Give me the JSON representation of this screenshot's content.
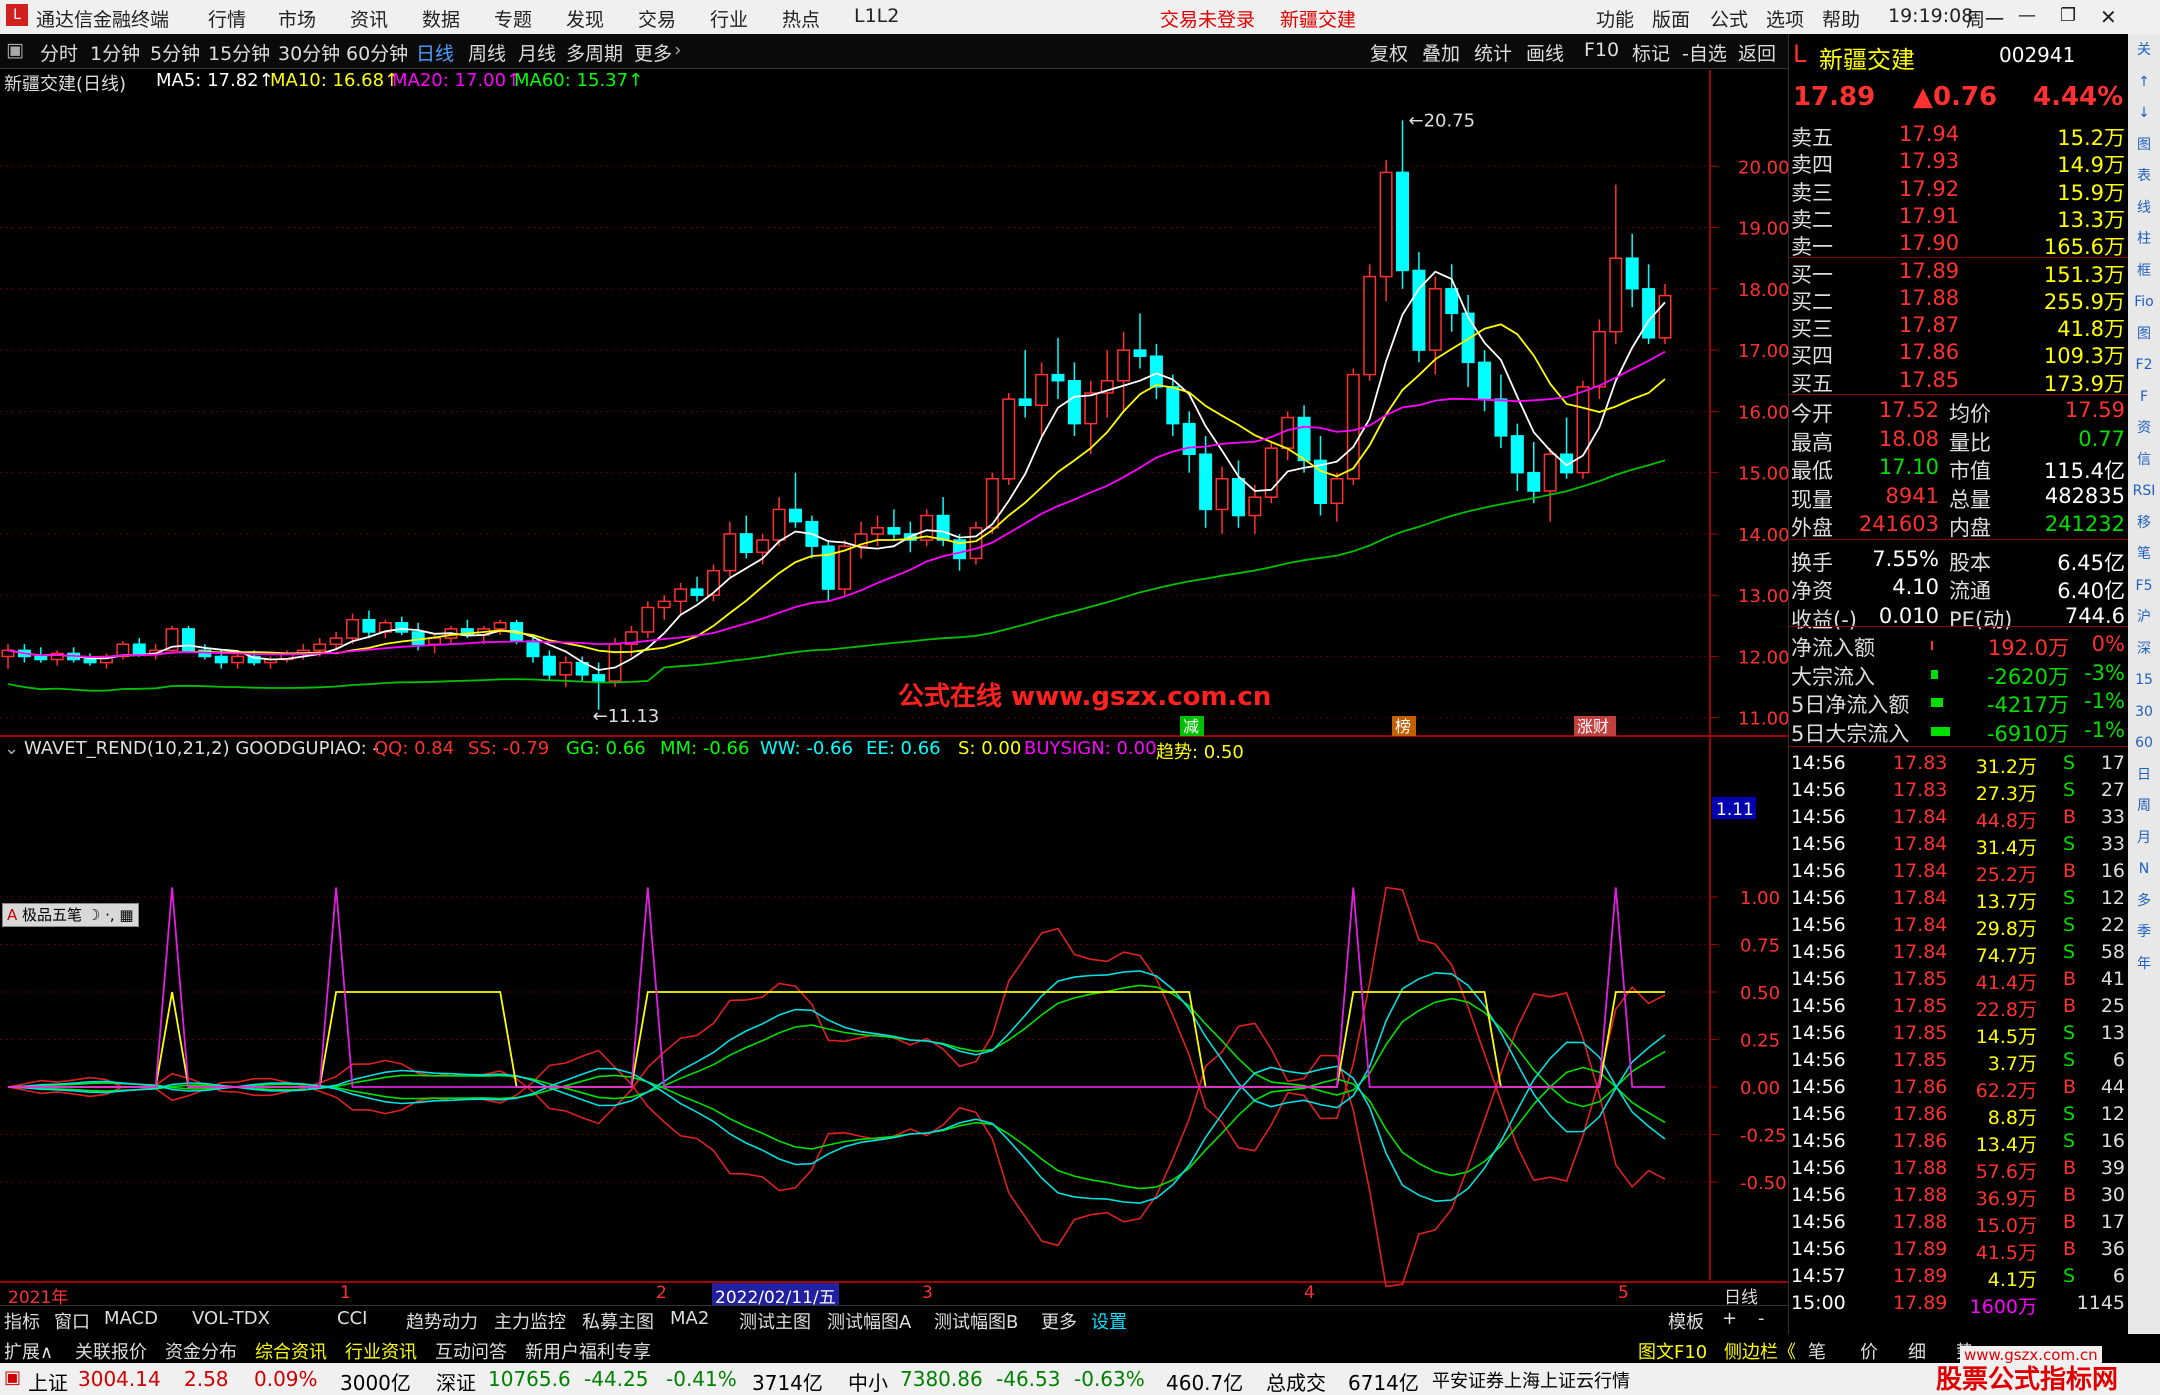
{
  "app": {
    "title": "通达信金融终端",
    "menu": [
      "行情",
      "市场",
      "资讯",
      "数据",
      "专题",
      "发现",
      "交易",
      "行业",
      "热点",
      "L1L2"
    ],
    "login_status": "交易未登录",
    "stock_tab": "新疆交建",
    "right_menu": [
      "功能",
      "版面",
      "公式",
      "选项",
      "帮助"
    ],
    "clock": "19:19:08",
    "weekday": "周一"
  },
  "toolbar": {
    "periods": [
      "分时",
      "1分钟",
      "5分钟",
      "15分钟",
      "30分钟",
      "60分钟",
      "日线",
      "周线",
      "月线",
      "多周期",
      "更多"
    ],
    "active_period": "日线",
    "actions": [
      "复权",
      "叠加",
      "统计",
      "画线",
      "F10",
      "标记",
      "-自选",
      "返回"
    ]
  },
  "main_chart": {
    "title": "新疆交建(日线)",
    "ma": [
      {
        "label": "MA5: 17.82",
        "color": "#ffffff"
      },
      {
        "label": "MA10: 16.68",
        "color": "#ffff00"
      },
      {
        "label": "MA20: 17.00",
        "color": "#ff00ff"
      },
      {
        "label": "MA60: 15.37",
        "color": "#00ff00"
      }
    ],
    "price_axis": [
      "20.00",
      "19.00",
      "18.00",
      "17.00",
      "16.00",
      "15.00",
      "14.00",
      "13.00",
      "12.00",
      "11.00"
    ],
    "high_marker": "20.75",
    "low_marker": "11.13",
    "watermark": "公式在线 www.gszx.com.cn",
    "event_tags": [
      {
        "label": "减",
        "color": "#00c000"
      },
      {
        "label": "榜",
        "color": "#c06000"
      },
      {
        "label": "涨财",
        "color": "#c04040"
      }
    ]
  },
  "indicator": {
    "title": "WAVET_REND(10,21,2) GOODGUPIAO: -",
    "values": [
      {
        "label": "QQ: 0.84",
        "color": "#ff3030"
      },
      {
        "label": "SS: -0.79",
        "color": "#ff3030"
      },
      {
        "label": "GG: 0.66",
        "color": "#00ff00"
      },
      {
        "label": "MM: -0.66",
        "color": "#00ff00"
      },
      {
        "label": "WW: -0.66",
        "color": "#00ffff"
      },
      {
        "label": "EE: 0.66",
        "color": "#00ffff"
      },
      {
        "label": "S: 0.00",
        "color": "#ffff00"
      },
      {
        "label": "BUYSIGN: 0.00",
        "color": "#ff00ff"
      },
      {
        "label": "趋势: 0.50",
        "color": "#ffff00"
      }
    ],
    "axis": [
      "1.00",
      "0.75",
      "0.50",
      "0.25",
      "0.00",
      "-0.25",
      "-0.50"
    ],
    "current_value": "1.11",
    "draw_tool": "极品五笔"
  },
  "time_axis": {
    "labels": [
      "2021年",
      "1",
      "2",
      "3",
      "4",
      "5"
    ],
    "cursor_date": "2022/02/11/五",
    "period": "日线"
  },
  "bottom_tabs": [
    "指标",
    "窗口",
    "MACD",
    "VOL-TDX",
    "CCI",
    "趋势动力",
    "主力监控",
    "私募主图",
    "MA2",
    "测试主图",
    "测试幅图A",
    "测试幅图B",
    "更多",
    "设置"
  ],
  "bottom_tabs_right": [
    "模板",
    "+",
    "-"
  ],
  "bottom_tabs2": [
    "扩展∧",
    "关联报价",
    "资金分布",
    "综合资讯",
    "行业资讯",
    "互动问答",
    "新用户福利专享"
  ],
  "bottom_tabs2_right": [
    "图文F10",
    "侧边栏《",
    "笔",
    "价",
    "细",
    "势"
  ],
  "quote": {
    "name": "新疆交建",
    "code": "002941",
    "price": "17.89",
    "change": "▲0.76",
    "pct": "4.44%",
    "asks": [
      {
        "label": "卖五",
        "price": "17.94",
        "vol": "15.2万"
      },
      {
        "label": "卖四",
        "price": "17.93",
        "vol": "14.9万"
      },
      {
        "label": "卖三",
        "price": "17.92",
        "vol": "15.9万"
      },
      {
        "label": "卖二",
        "price": "17.91",
        "vol": "13.3万"
      },
      {
        "label": "卖一",
        "price": "17.90",
        "vol": "165.6万"
      }
    ],
    "bids": [
      {
        "label": "买一",
        "price": "17.89",
        "vol": "151.3万"
      },
      {
        "label": "买二",
        "price": "17.88",
        "vol": "255.9万"
      },
      {
        "label": "买三",
        "price": "17.87",
        "vol": "41.8万"
      },
      {
        "label": "买四",
        "price": "17.86",
        "vol": "109.3万"
      },
      {
        "label": "买五",
        "price": "17.85",
        "vol": "173.9万"
      }
    ],
    "stats": [
      {
        "k1": "今开",
        "v1": "17.52",
        "c1": "#ff3030",
        "k2": "均价",
        "v2": "17.59",
        "c2": "#ff3030"
      },
      {
        "k1": "最高",
        "v1": "18.08",
        "c1": "#ff3030",
        "k2": "量比",
        "v2": "0.77",
        "c2": "#00e000"
      },
      {
        "k1": "最低",
        "v1": "17.10",
        "c1": "#00e000",
        "k2": "市值",
        "v2": "115.4亿",
        "c2": "#ffffff"
      },
      {
        "k1": "现量",
        "v1": "8941",
        "c1": "#ff3030",
        "k2": "总量",
        "v2": "482835",
        "c2": "#ffffff"
      },
      {
        "k1": "外盘",
        "v1": "241603",
        "c1": "#ff3030",
        "k2": "内盘",
        "v2": "241232",
        "c2": "#00e000"
      },
      {
        "k1": "换手",
        "v1": "7.55%",
        "c1": "#ffffff",
        "k2": "股本",
        "v2": "6.45亿",
        "c2": "#ffffff"
      },
      {
        "k1": "净资",
        "v1": "4.10",
        "c1": "#ffffff",
        "k2": "流通",
        "v2": "6.40亿",
        "c2": "#ffffff"
      },
      {
        "k1": "收益(-)",
        "v1": "0.010",
        "c1": "#ffffff",
        "k2": "PE(动)",
        "v2": "744.6",
        "c2": "#ffffff"
      }
    ],
    "flows": [
      {
        "label": "净流入额",
        "val": "192.0万",
        "pct": "0%",
        "color": "#ff3030",
        "bar": 0.02
      },
      {
        "label": "大宗流入",
        "val": "-2620万",
        "pct": "-3%",
        "color": "#00e000",
        "bar": 0.3
      },
      {
        "label": "5日净流入额",
        "val": "-4217万",
        "pct": "-1%",
        "color": "#00e000",
        "bar": 0.5
      },
      {
        "label": "5日大宗流入",
        "val": "-6910万",
        "pct": "-1%",
        "color": "#00e000",
        "bar": 0.8
      }
    ],
    "ticks": [
      {
        "t": "14:56",
        "p": "17.83",
        "v": "31.2万",
        "d": "S",
        "n": "17"
      },
      {
        "t": "14:56",
        "p": "17.83",
        "v": "27.3万",
        "d": "S",
        "n": "27"
      },
      {
        "t": "14:56",
        "p": "17.84",
        "v": "44.8万",
        "d": "B",
        "n": "33"
      },
      {
        "t": "14:56",
        "p": "17.84",
        "v": "31.4万",
        "d": "S",
        "n": "33"
      },
      {
        "t": "14:56",
        "p": "17.84",
        "v": "25.2万",
        "d": "B",
        "n": "16"
      },
      {
        "t": "14:56",
        "p": "17.84",
        "v": "13.7万",
        "d": "S",
        "n": "12"
      },
      {
        "t": "14:56",
        "p": "17.84",
        "v": "29.8万",
        "d": "S",
        "n": "22"
      },
      {
        "t": "14:56",
        "p": "17.84",
        "v": "74.7万",
        "d": "S",
        "n": "58"
      },
      {
        "t": "14:56",
        "p": "17.85",
        "v": "41.4万",
        "d": "B",
        "n": "41"
      },
      {
        "t": "14:56",
        "p": "17.85",
        "v": "22.8万",
        "d": "B",
        "n": "25"
      },
      {
        "t": "14:56",
        "p": "17.85",
        "v": "14.5万",
        "d": "S",
        "n": "13"
      },
      {
        "t": "14:56",
        "p": "17.85",
        "v": "3.7万",
        "d": "S",
        "n": "6"
      },
      {
        "t": "14:56",
        "p": "17.86",
        "v": "62.2万",
        "d": "B",
        "n": "44"
      },
      {
        "t": "14:56",
        "p": "17.86",
        "v": "8.8万",
        "d": "S",
        "n": "12"
      },
      {
        "t": "14:56",
        "p": "17.86",
        "v": "13.4万",
        "d": "S",
        "n": "16"
      },
      {
        "t": "14:56",
        "p": "17.88",
        "v": "57.6万",
        "d": "B",
        "n": "39"
      },
      {
        "t": "14:56",
        "p": "17.88",
        "v": "36.9万",
        "d": "B",
        "n": "30"
      },
      {
        "t": "14:56",
        "p": "17.88",
        "v": "15.0万",
        "d": "B",
        "n": "17"
      },
      {
        "t": "14:56",
        "p": "17.89",
        "v": "41.5万",
        "d": "B",
        "n": "36"
      },
      {
        "t": "14:57",
        "p": "17.89",
        "v": "4.1万",
        "d": "S",
        "n": "6"
      },
      {
        "t": "15:00",
        "p": "17.89",
        "v": "1600万",
        "d": "",
        "n": "1145"
      }
    ]
  },
  "right_icons": [
    "关",
    "↑",
    "↓",
    "图",
    "表",
    "线",
    "柱",
    "框",
    "Fio",
    "图",
    "F2",
    "F",
    "资",
    "信",
    "RSI",
    "移",
    "笔",
    "F5",
    "沪",
    "深",
    "15",
    "30",
    "60",
    "日",
    "周",
    "月",
    "N",
    "多",
    "季",
    "年"
  ],
  "status": {
    "sh_label": "上证",
    "sh_val": "3004.14",
    "sh_chg": "2.58",
    "sh_pct": "0.09%",
    "sh_amt": "3000亿",
    "sz_label": "深证",
    "sz_val": "10765.6",
    "sz_chg": "-44.25",
    "sz_pct": "-0.41%",
    "sz_amt": "3714亿",
    "zx_label": "中小",
    "zx_val": "7380.86",
    "zx_chg": "-46.53",
    "zx_pct": "-0.63%",
    "zx_amt": "460.7亿",
    "total_label": "总成交",
    "total_val": "6714亿",
    "broker": "平安证券上海上证云行情",
    "brand": "股票公式指标网",
    "brand_url": "www.gszx.com.cn"
  },
  "colors": {
    "up": "#ff3030",
    "down": "#00ffff",
    "ma5": "#ffffff",
    "ma10": "#ffff00",
    "ma20": "#ff00ff",
    "ma60": "#00c000"
  },
  "chart_data": {
    "type": "candlestick",
    "price_range": [
      10.8,
      21.0
    ],
    "ohlc": [
      [
        12.0,
        12.2,
        11.8,
        12.1
      ],
      [
        12.1,
        12.2,
        11.9,
        12.0
      ],
      [
        12.0,
        12.15,
        11.9,
        11.95
      ],
      [
        11.95,
        12.1,
        11.85,
        12.05
      ],
      [
        12.05,
        12.15,
        11.9,
        11.95
      ],
      [
        11.95,
        12.05,
        11.85,
        11.9
      ],
      [
        11.9,
        12.05,
        11.8,
        12.0
      ],
      [
        12.0,
        12.25,
        11.95,
        12.2
      ],
      [
        12.2,
        12.3,
        12.0,
        12.05
      ],
      [
        12.05,
        12.2,
        11.95,
        12.1
      ],
      [
        12.1,
        12.5,
        12.05,
        12.45
      ],
      [
        12.45,
        12.5,
        12.05,
        12.1
      ],
      [
        12.1,
        12.2,
        11.95,
        12.0
      ],
      [
        12.0,
        12.1,
        11.8,
        11.9
      ],
      [
        11.9,
        12.05,
        11.8,
        12.0
      ],
      [
        12.0,
        12.1,
        11.85,
        11.9
      ],
      [
        11.9,
        12.0,
        11.8,
        11.95
      ],
      [
        11.95,
        12.1,
        11.9,
        12.05
      ],
      [
        12.05,
        12.2,
        11.95,
        12.1
      ],
      [
        12.1,
        12.3,
        12.0,
        12.2
      ],
      [
        12.2,
        12.4,
        12.1,
        12.3
      ],
      [
        12.3,
        12.7,
        12.2,
        12.6
      ],
      [
        12.6,
        12.75,
        12.3,
        12.4
      ],
      [
        12.4,
        12.6,
        12.3,
        12.55
      ],
      [
        12.55,
        12.65,
        12.35,
        12.4
      ],
      [
        12.4,
        12.55,
        12.1,
        12.2
      ],
      [
        12.2,
        12.35,
        12.05,
        12.3
      ],
      [
        12.3,
        12.5,
        12.2,
        12.45
      ],
      [
        12.45,
        12.6,
        12.3,
        12.35
      ],
      [
        12.35,
        12.5,
        12.2,
        12.45
      ],
      [
        12.45,
        12.6,
        12.35,
        12.55
      ],
      [
        12.55,
        12.6,
        12.2,
        12.25
      ],
      [
        12.25,
        12.3,
        11.9,
        12.0
      ],
      [
        12.0,
        12.1,
        11.6,
        11.7
      ],
      [
        11.7,
        12.0,
        11.5,
        11.9
      ],
      [
        11.9,
        12.0,
        11.6,
        11.7
      ],
      [
        11.7,
        11.9,
        11.13,
        11.6
      ],
      [
        11.6,
        12.3,
        11.5,
        12.2
      ],
      [
        12.2,
        12.5,
        12.0,
        12.4
      ],
      [
        12.4,
        12.9,
        12.3,
        12.8
      ],
      [
        12.8,
        13.0,
        12.6,
        12.9
      ],
      [
        12.9,
        13.2,
        12.7,
        13.1
      ],
      [
        13.1,
        13.3,
        12.9,
        13.0
      ],
      [
        13.0,
        13.5,
        12.9,
        13.4
      ],
      [
        13.4,
        14.2,
        13.3,
        14.0
      ],
      [
        14.0,
        14.3,
        13.6,
        13.7
      ],
      [
        13.7,
        14.0,
        13.5,
        13.9
      ],
      [
        13.9,
        14.6,
        13.8,
        14.4
      ],
      [
        14.4,
        15.0,
        14.1,
        14.2
      ],
      [
        14.2,
        14.3,
        13.6,
        13.8
      ],
      [
        13.8,
        13.9,
        12.9,
        13.1
      ],
      [
        13.1,
        13.9,
        13.0,
        13.8
      ],
      [
        13.8,
        14.2,
        13.6,
        14.0
      ],
      [
        14.0,
        14.3,
        13.8,
        14.1
      ],
      [
        14.1,
        14.4,
        13.9,
        14.0
      ],
      [
        14.0,
        14.2,
        13.7,
        13.9
      ],
      [
        13.9,
        14.4,
        13.8,
        14.3
      ],
      [
        14.3,
        14.6,
        13.8,
        13.9
      ],
      [
        13.9,
        14.0,
        13.4,
        13.6
      ],
      [
        13.6,
        14.2,
        13.5,
        14.1
      ],
      [
        14.1,
        15.0,
        14.0,
        14.9
      ],
      [
        14.9,
        16.3,
        14.8,
        16.2
      ],
      [
        16.2,
        17.0,
        15.9,
        16.1
      ],
      [
        16.1,
        16.8,
        15.6,
        16.6
      ],
      [
        16.6,
        17.2,
        16.2,
        16.5
      ],
      [
        16.5,
        16.8,
        15.6,
        15.8
      ],
      [
        15.8,
        16.5,
        15.3,
        16.3
      ],
      [
        16.3,
        17.0,
        15.9,
        16.5
      ],
      [
        16.5,
        17.3,
        16.0,
        17.0
      ],
      [
        17.0,
        17.6,
        16.7,
        16.9
      ],
      [
        16.9,
        17.1,
        16.2,
        16.4
      ],
      [
        16.4,
        16.6,
        15.6,
        15.8
      ],
      [
        15.8,
        16.0,
        15.0,
        15.3
      ],
      [
        15.3,
        15.6,
        14.1,
        14.4
      ],
      [
        14.4,
        15.1,
        14.0,
        14.9
      ],
      [
        14.9,
        15.2,
        14.1,
        14.3
      ],
      [
        14.3,
        14.8,
        14.0,
        14.6
      ],
      [
        14.6,
        15.5,
        14.5,
        15.4
      ],
      [
        15.4,
        16.0,
        15.2,
        15.9
      ],
      [
        15.9,
        16.1,
        15.0,
        15.2
      ],
      [
        15.2,
        15.6,
        14.3,
        14.5
      ],
      [
        14.5,
        15.0,
        14.2,
        14.9
      ],
      [
        14.9,
        16.7,
        14.8,
        16.6
      ],
      [
        16.6,
        18.4,
        16.5,
        18.2
      ],
      [
        18.2,
        20.1,
        17.8,
        19.9
      ],
      [
        19.9,
        20.75,
        18.0,
        18.3
      ],
      [
        18.3,
        18.6,
        16.8,
        17.0
      ],
      [
        17.0,
        18.2,
        16.6,
        18.0
      ],
      [
        18.0,
        18.4,
        17.3,
        17.6
      ],
      [
        17.6,
        17.9,
        16.4,
        16.8
      ],
      [
        16.8,
        17.0,
        16.0,
        16.2
      ],
      [
        16.2,
        16.6,
        15.4,
        15.6
      ],
      [
        15.6,
        15.8,
        14.7,
        15.0
      ],
      [
        15.0,
        15.5,
        14.5,
        14.7
      ],
      [
        14.7,
        15.4,
        14.2,
        15.3
      ],
      [
        15.3,
        15.9,
        14.9,
        15.0
      ],
      [
        15.0,
        16.5,
        14.9,
        16.4
      ],
      [
        16.4,
        17.5,
        16.2,
        17.3
      ],
      [
        17.3,
        19.7,
        17.1,
        18.5
      ],
      [
        18.5,
        18.9,
        17.7,
        18.0
      ],
      [
        18.0,
        18.4,
        17.1,
        17.2
      ],
      [
        17.2,
        18.08,
        17.1,
        17.89
      ]
    ]
  }
}
